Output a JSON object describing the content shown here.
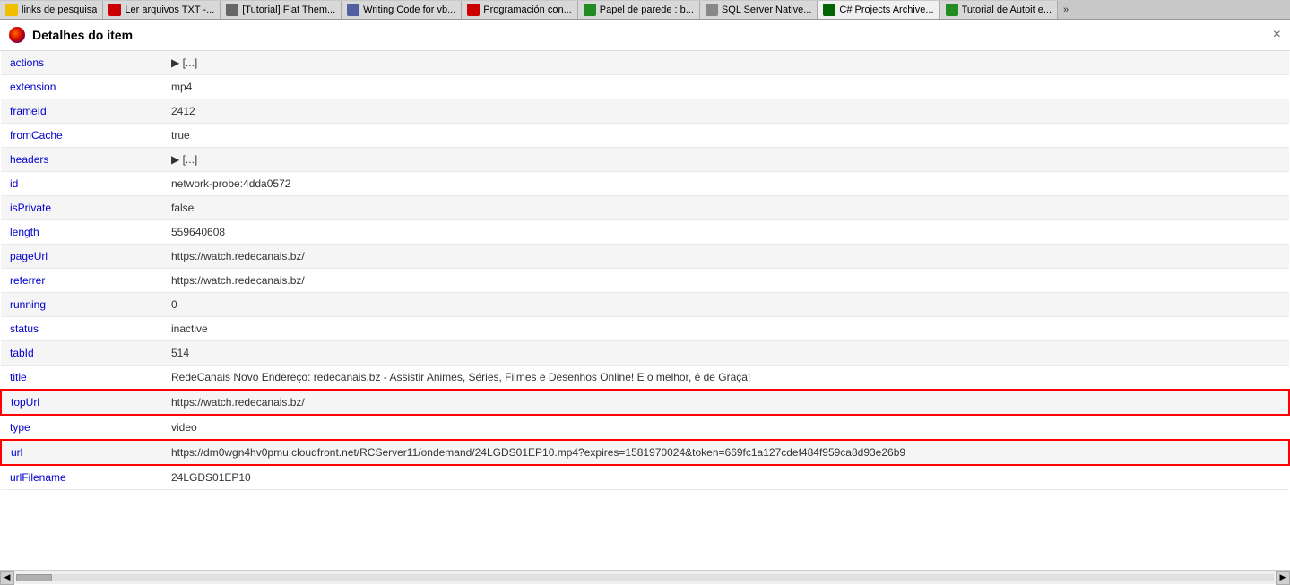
{
  "tabs": [
    {
      "id": "tab1",
      "label": "links de pesquisa",
      "icon_color": "#f0c000",
      "active": false
    },
    {
      "id": "tab2",
      "label": "Ler arquivos TXT -...",
      "icon_color": "#cc0000",
      "active": false
    },
    {
      "id": "tab3",
      "label": "[Tutorial] Flat Them...",
      "icon_color": "#666",
      "active": false
    },
    {
      "id": "tab4",
      "label": "Writing Code for vb...",
      "icon_color": "#5060a0",
      "active": false
    },
    {
      "id": "tab5",
      "label": "Programación con...",
      "icon_color": "#cc0000",
      "active": false
    },
    {
      "id": "tab6",
      "label": "Papel de parede : b...",
      "icon_color": "#228B22",
      "active": false
    },
    {
      "id": "tab7",
      "label": "SQL Server Native...",
      "icon_color": "#888",
      "active": false
    },
    {
      "id": "tab8",
      "label": "C# Projects Archive...",
      "icon_color": "#006400",
      "active": true
    },
    {
      "id": "tab9",
      "label": "Tutorial de Autoit e...",
      "icon_color": "#228B22",
      "active": false
    }
  ],
  "panel": {
    "title": "Detalhes do item",
    "close_label": "×"
  },
  "rows": [
    {
      "key": "actions",
      "value": "▶ [...]",
      "has_arrow": true,
      "highlight": false
    },
    {
      "key": "extension",
      "value": "mp4",
      "has_arrow": false,
      "highlight": false
    },
    {
      "key": "frameId",
      "value": "2412",
      "has_arrow": false,
      "highlight": false
    },
    {
      "key": "fromCache",
      "value": "true",
      "has_arrow": false,
      "highlight": false
    },
    {
      "key": "headers",
      "value": "▶ [...]",
      "has_arrow": true,
      "highlight": false
    },
    {
      "key": "id",
      "value": "network-probe:4dda0572",
      "has_arrow": false,
      "highlight": false
    },
    {
      "key": "isPrivate",
      "value": "false",
      "has_arrow": false,
      "highlight": false
    },
    {
      "key": "length",
      "value": "559640608",
      "has_arrow": false,
      "highlight": false
    },
    {
      "key": "pageUrl",
      "value": "https://watch.redecanais.bz/",
      "has_arrow": false,
      "highlight": false
    },
    {
      "key": "referrer",
      "value": "https://watch.redecanais.bz/",
      "has_arrow": false,
      "highlight": false
    },
    {
      "key": "running",
      "value": "0",
      "has_arrow": false,
      "highlight": false
    },
    {
      "key": "status",
      "value": "inactive",
      "has_arrow": false,
      "highlight": false
    },
    {
      "key": "tabId",
      "value": "514",
      "has_arrow": false,
      "highlight": false
    },
    {
      "key": "title",
      "value": "RedeCanais Novo Endereço: redecanais.bz - Assistir Animes, Séries, Filmes e Desenhos Online! E o melhor, é de Graça!",
      "has_arrow": false,
      "highlight": false
    },
    {
      "key": "topUrl",
      "value": "https://watch.redecanais.bz/",
      "has_arrow": false,
      "highlight": true
    },
    {
      "key": "type",
      "value": "video",
      "has_arrow": false,
      "highlight": false
    },
    {
      "key": "url",
      "value": "https://dm0wgn4hv0pmu.cloudfront.net/RCServer11/ondemand/24LGDS01EP10.mp4?expires=1581970024&token=669fc1a127cdef484f959ca8d93e26b9",
      "has_arrow": false,
      "highlight": true
    },
    {
      "key": "urlFilename",
      "value": "24LGDS01EP10",
      "has_arrow": false,
      "highlight": false
    }
  ]
}
